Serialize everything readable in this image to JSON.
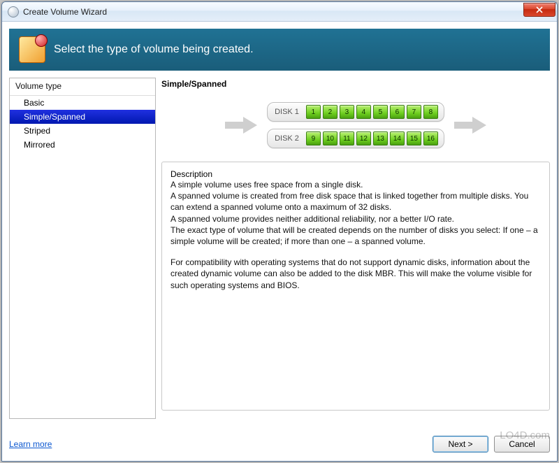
{
  "window": {
    "title": "Create Volume Wizard",
    "close_tooltip": "Close"
  },
  "banner": {
    "headline": "Select the type of volume being created."
  },
  "sidebar": {
    "header": "Volume type",
    "items": [
      {
        "label": "Basic",
        "selected": false
      },
      {
        "label": "Simple/Spanned",
        "selected": true
      },
      {
        "label": "Striped",
        "selected": false
      },
      {
        "label": "Mirrored",
        "selected": false
      }
    ]
  },
  "rightpane": {
    "title": "Simple/Spanned",
    "disks": [
      {
        "label": "DISK 1",
        "blocks": [
          "1",
          "2",
          "3",
          "4",
          "5",
          "6",
          "7",
          "8"
        ]
      },
      {
        "label": "DISK 2",
        "blocks": [
          "9",
          "10",
          "11",
          "12",
          "13",
          "14",
          "15",
          "16"
        ]
      }
    ],
    "description": {
      "legend": "Description",
      "p1": "A simple volume uses free space from a single disk.",
      "p2": "A spanned volume is created from free disk space that is linked together from multiple disks. You can extend a spanned volume onto a maximum of 32 disks.",
      "p3": "A spanned volume provides neither additional reliability, nor a better I/O rate.",
      "p4": "The exact type of volume that will be created depends on the number of disks you select: If one – a simple volume will be created; if more than one – a spanned volume.",
      "p5": "For compatibility with operating systems that do not support dynamic disks, information about the created dynamic volume can also be added to the disk MBR. This will make the volume visible for such operating systems and BIOS."
    }
  },
  "footer": {
    "learn_more": "Learn more",
    "next": "Next >",
    "cancel": "Cancel"
  },
  "watermark": "LO4D.com"
}
